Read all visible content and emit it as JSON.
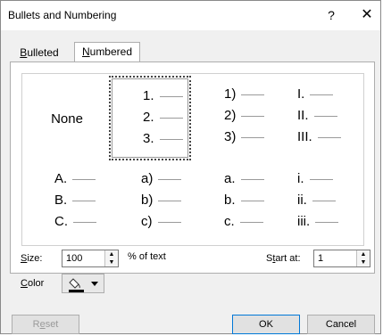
{
  "window": {
    "title": "Bullets and Numbering",
    "help_glyph": "?",
    "close_glyph": "✕"
  },
  "tabs": [
    {
      "label_pre": "",
      "label_u": "B",
      "label_post": "ulleted",
      "selected": false
    },
    {
      "label_pre": "",
      "label_u": "N",
      "label_post": "umbered",
      "selected": true
    }
  ],
  "gallery": {
    "none_label": "None",
    "cells": [
      {
        "style": "none",
        "lines": [],
        "selected": false
      },
      {
        "style": "arabic-period",
        "lines": [
          "1.",
          "2.",
          "3."
        ],
        "selected": true
      },
      {
        "style": "arabic-paren",
        "lines": [
          "1)",
          "2)",
          "3)"
        ],
        "selected": false
      },
      {
        "style": "roman-upper",
        "lines": [
          "I.",
          "II.",
          "III."
        ],
        "selected": false
      },
      {
        "style": "alpha-upper",
        "lines": [
          "A.",
          "B.",
          "C."
        ],
        "selected": false
      },
      {
        "style": "alpha-lower-paren",
        "lines": [
          "a)",
          "b)",
          "c)"
        ],
        "selected": false
      },
      {
        "style": "alpha-lower-period",
        "lines": [
          "a.",
          "b.",
          "c."
        ],
        "selected": false
      },
      {
        "style": "roman-lower",
        "lines": [
          "i.",
          "ii.",
          "iii."
        ],
        "selected": false
      }
    ]
  },
  "size": {
    "label_u": "S",
    "label_rest": "ize:",
    "value": "100",
    "suffix": "% of text"
  },
  "start_at": {
    "label_pre": "S",
    "label_u": "t",
    "label_post": "art at:",
    "value": "1"
  },
  "color": {
    "label_u": "C",
    "label_rest": "olor",
    "icon": "paint-bucket-icon"
  },
  "buttons": {
    "reset_u": "e",
    "reset_pre": "R",
    "reset_post": "set",
    "ok": "OK",
    "cancel": "Cancel"
  },
  "colors": {
    "title_bg": "#ffffff",
    "dialog_bg": "#f0f0f0",
    "default_btn_border": "#0078d7"
  }
}
